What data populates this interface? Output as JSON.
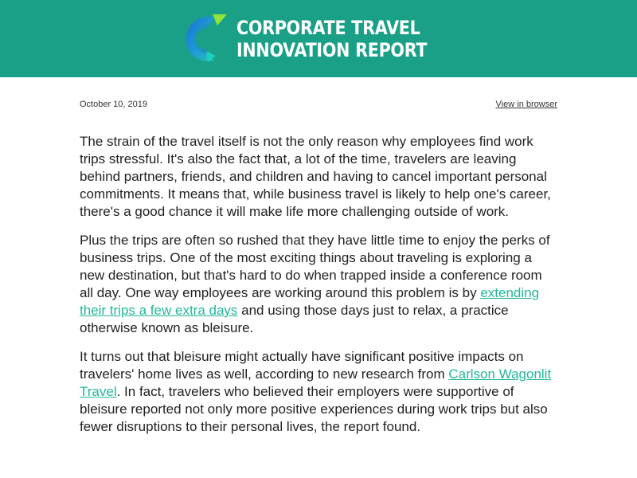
{
  "header": {
    "logo_icon": "ct-logo-icon",
    "title_line1": "CORPORATE TRAVEL",
    "title_line2": "INNOVATION REPORT",
    "bg_color": "#1aa087"
  },
  "meta": {
    "date": "October 10, 2019",
    "view_in_browser": "View in browser"
  },
  "article": {
    "p1": "The strain of the travel itself is not the only reason why employees find work trips stressful. It's also the fact that, a lot of the time, travelers are leaving behind partners, friends, and children and having to cancel important personal commitments. It means that, while business travel is likely to help one's career, there's a good chance it will make life more challenging outside of work.",
    "p2_before": "Plus the trips are often so rushed that they have little time to enjoy the perks of business trips. One of the most exciting things about traveling is exploring a new destination, but that's hard to do when trapped inside a conference room all day. One way employees are working around this problem is by ",
    "p2_link": "extending their trips a few extra days",
    "p2_after": " and using those days just to relax, a practice otherwise known as bleisure.",
    "p3_before": "It turns out that bleisure might actually have significant positive impacts on travelers' home lives as well, according to new research from ",
    "p3_link": "Carlson Wagonlit Travel",
    "p3_after": ". In fact, travelers who believed their employers were supportive of bleisure reported not only more positive experiences during work trips but also fewer disruptions to their personal lives, the report found.",
    "link_color": "#22b89a"
  }
}
